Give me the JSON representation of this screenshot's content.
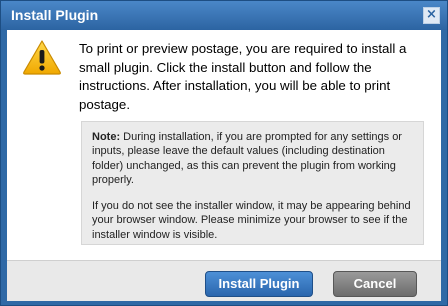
{
  "dialog": {
    "title": "Install Plugin",
    "close_symbol": "×",
    "icon": "warning-icon",
    "message": "To print or preview postage, you are required to install a small plugin. Click the install button and follow the instructions. After installation, you will be able to print postage.",
    "note": {
      "label": "Note:",
      "text": " During installation, if you are prompted for any settings or inputs, please leave the default values (including destination folder) unchanged, as this can prevent the plugin from working properly.",
      "followup": "If you do not see the installer window, it may be appearing behind your browser window. Please minimize your browser to see if the installer window is visible."
    }
  },
  "buttons": {
    "install_label": "Install Plugin",
    "cancel_label": "Cancel"
  },
  "colors": {
    "titlebar": "#2c64a2",
    "primary_button": "#2a66ad",
    "secondary_button": "#6c6c6c",
    "warning": "#f5b800"
  }
}
